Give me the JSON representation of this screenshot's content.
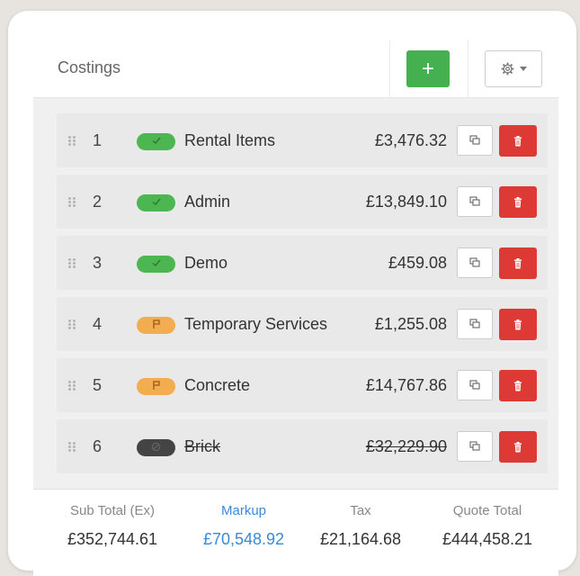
{
  "header": {
    "title": "Costings",
    "add_label": "+"
  },
  "rows": [
    {
      "num": "1",
      "name": "Rental Items",
      "amount": "£3,476.32",
      "status": "green",
      "struck": false
    },
    {
      "num": "2",
      "name": "Admin",
      "amount": "£13,849.10",
      "status": "green",
      "struck": false
    },
    {
      "num": "3",
      "name": "Demo",
      "amount": "£459.08",
      "status": "green",
      "struck": false
    },
    {
      "num": "4",
      "name": "Temporary Services",
      "amount": "£1,255.08",
      "status": "orange",
      "struck": false
    },
    {
      "num": "5",
      "name": "Concrete",
      "amount": "£14,767.86",
      "status": "orange",
      "struck": false
    },
    {
      "num": "6",
      "name": "Brick",
      "amount": "£32,229.90",
      "status": "dark",
      "struck": true
    }
  ],
  "status_icons": {
    "green": "check-icon",
    "orange": "flag-icon",
    "dark": "ban-icon"
  },
  "footer": {
    "sub_total_label": "Sub Total (Ex)",
    "sub_total": "£352,744.61",
    "markup_label": "Markup",
    "markup": "£70,548.92",
    "tax_label": "Tax",
    "tax": "£21,164.68",
    "quote_total_label": "Quote Total",
    "quote_total": "£444,458.21"
  },
  "colors": {
    "accent_green": "#44b04f",
    "danger_red": "#de3a35",
    "markup_blue": "#3a8ad9",
    "warning_orange": "#f3ac50"
  }
}
